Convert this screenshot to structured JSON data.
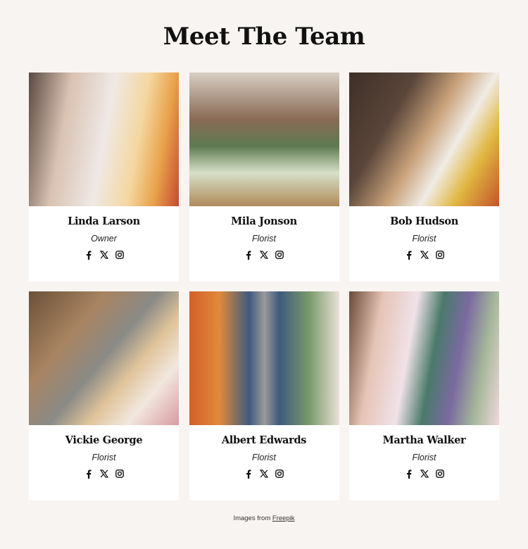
{
  "page": {
    "title": "Meet The Team"
  },
  "team": [
    {
      "name": "Linda Larson",
      "role": "Owner",
      "photo": "florist-cutting-flowers"
    },
    {
      "name": "Mila Jonson",
      "role": "Florist",
      "photo": "florist-holding-flower-basket"
    },
    {
      "name": "Bob Hudson",
      "role": "Florist",
      "photo": "florist-arranging-sunflowers"
    },
    {
      "name": "Vickie George",
      "role": "Florist",
      "photo": "florist-arranging-roses"
    },
    {
      "name": "Albert Edwards",
      "role": "Florist",
      "photo": "florist-in-apron-smiling"
    },
    {
      "name": "Martha Walker",
      "role": "Florist",
      "photo": "florist-smelling-flowers"
    }
  ],
  "socials": [
    "facebook-icon",
    "x-icon",
    "instagram-icon"
  ],
  "footer": {
    "credit_text": "Images from ",
    "credit_link": "Freepik"
  }
}
